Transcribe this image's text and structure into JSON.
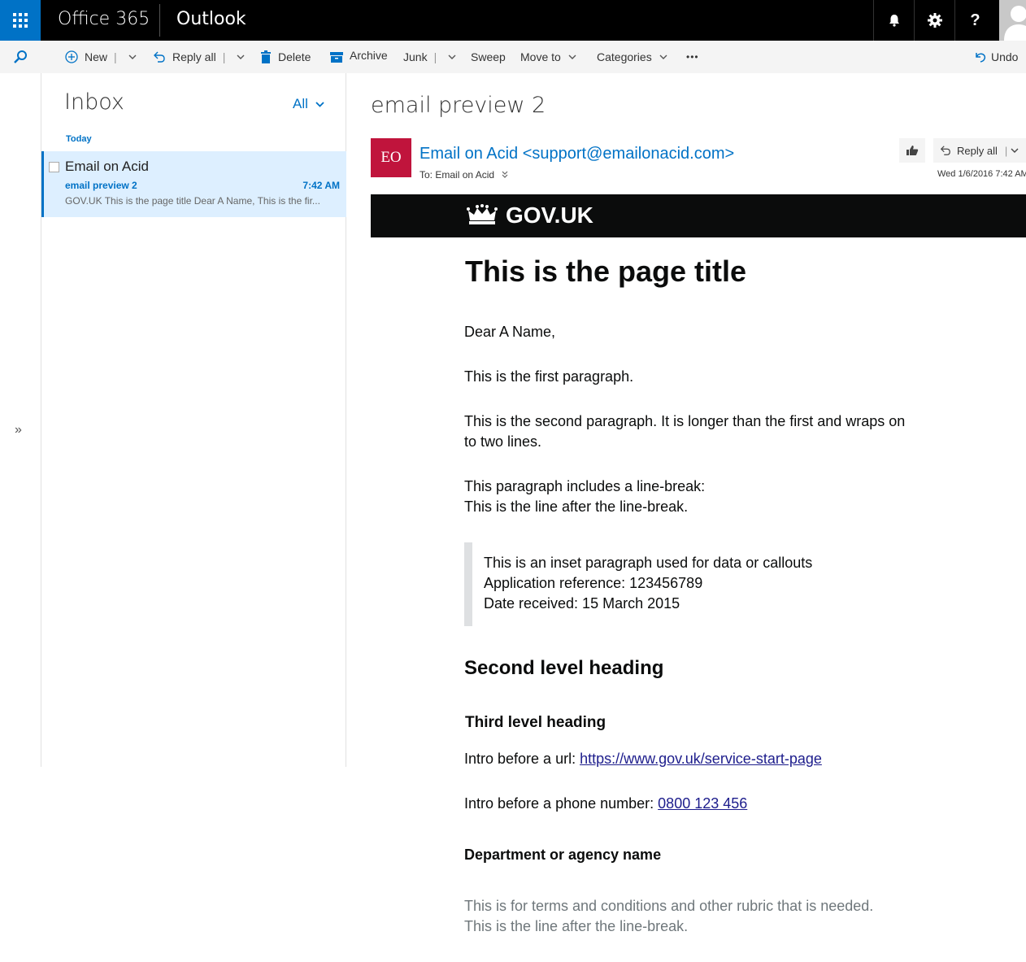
{
  "topbar": {
    "brand": "Office 365",
    "app": "Outlook"
  },
  "icons": {
    "app_launcher": "waffle-icon",
    "notifications": "bell-icon",
    "settings": "gear-icon",
    "help": "help-icon",
    "search": "search-icon"
  },
  "commands": {
    "new": "New",
    "reply_all": "Reply all",
    "delete": "Delete",
    "archive": "Archive",
    "junk": "Junk",
    "sweep": "Sweep",
    "move_to": "Move to",
    "categories": "Categories",
    "more": "•••",
    "undo": "Undo"
  },
  "rail": {
    "expand": "»"
  },
  "list": {
    "folder": "Inbox",
    "filter": "All",
    "group": "Today",
    "items": [
      {
        "sender": "Email on Acid",
        "subject": "email preview 2",
        "time": "7:42 AM",
        "preview": "GOV.UK This is the page title Dear A Name, This is the fir..."
      }
    ]
  },
  "reading": {
    "subject": "email preview 2",
    "avatar_initials": "EO",
    "avatar_color": "#c0143c",
    "from": "Email on Acid <support@emailonacid.com>",
    "to_label": "To:",
    "to": "Email on Acid",
    "reply_all": "Reply all",
    "date": "Wed 1/6/2016 7:42 AM"
  },
  "email": {
    "logo": "GOV.UK",
    "title": "This is the page title",
    "greeting": "Dear A Name,",
    "para1": "This is the first paragraph.",
    "para2_line1": "This is the second paragraph. It is longer than the first and wraps on",
    "para2_line2": "to two lines.",
    "para3_line1": "This paragraph includes a line-break:",
    "para3_line2": "This is the line after the line-break.",
    "inset_line1": "This is an inset paragraph used for data or callouts",
    "inset_line2": "Application reference: 123456789",
    "inset_line3": "Date received: 15 March 2015",
    "h2": "Second level heading",
    "h3": "Third level heading",
    "url_intro": "Intro before a url: ",
    "url": "https://www.gov.uk/service-start-page",
    "phone_intro": "Intro before a phone number: ",
    "phone": "0800 123 456",
    "dept": "Department or agency name",
    "rubric_line1": "This is for terms and conditions and other rubric that is needed.",
    "rubric_line2": "This is the line after the line-break."
  },
  "colors": {
    "accent": "#0072c6",
    "topbar": "#000000",
    "selected_item": "#ddefff",
    "gov_banner": "#0b0c0c"
  }
}
